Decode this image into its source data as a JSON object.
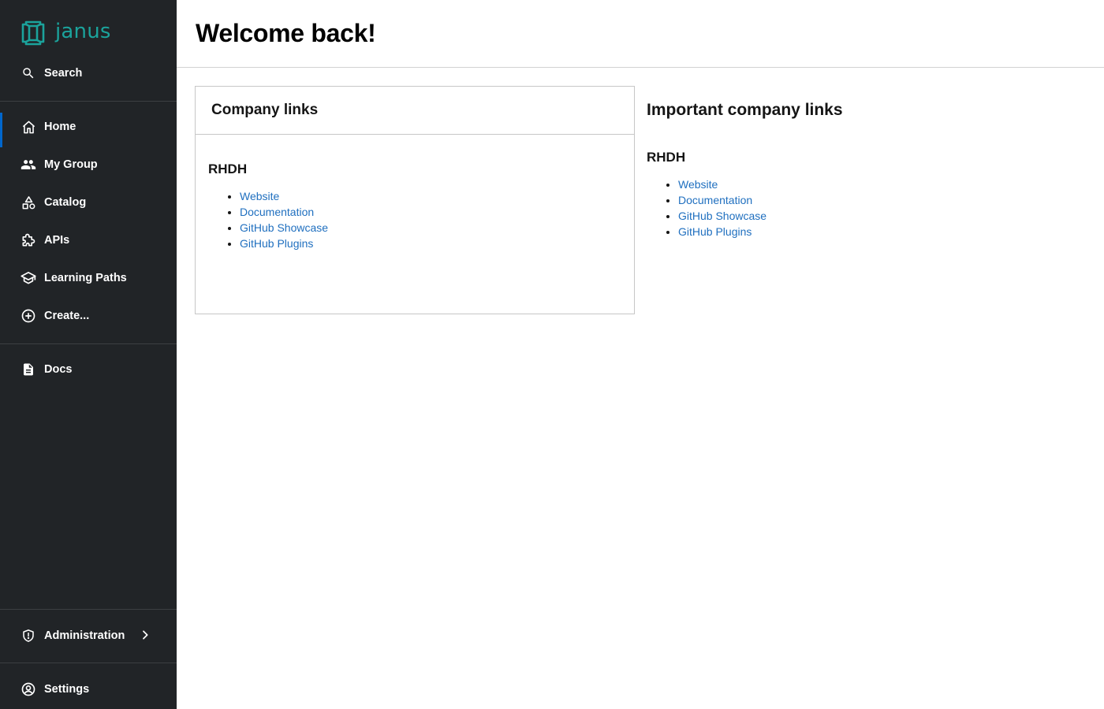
{
  "brand": {
    "name": "janus",
    "color": "#1ba39c"
  },
  "sidebar": {
    "search_label": "Search",
    "items": [
      {
        "label": "Home",
        "icon": "home-icon",
        "active": true
      },
      {
        "label": "My Group",
        "icon": "group-icon"
      },
      {
        "label": "Catalog",
        "icon": "catalog-icon"
      },
      {
        "label": "APIs",
        "icon": "puzzle-icon"
      },
      {
        "label": "Learning Paths",
        "icon": "school-icon"
      },
      {
        "label": "Create...",
        "icon": "add-circle-icon"
      }
    ],
    "docs_label": "Docs",
    "admin_label": "Administration",
    "settings_label": "Settings"
  },
  "header": {
    "title": "Welcome back!"
  },
  "company_links_card": {
    "title": "Company links",
    "group": "RHDH",
    "links": [
      "Website",
      "Documentation",
      "GitHub Showcase",
      "GitHub Plugins"
    ]
  },
  "important_links": {
    "title": "Important company links",
    "group": "RHDH",
    "links": [
      "Website",
      "Documentation",
      "GitHub Showcase",
      "GitHub Plugins"
    ]
  },
  "colors": {
    "sidebar_bg": "#212427",
    "accent": "#0066cc",
    "link": "#1f6fbf"
  }
}
